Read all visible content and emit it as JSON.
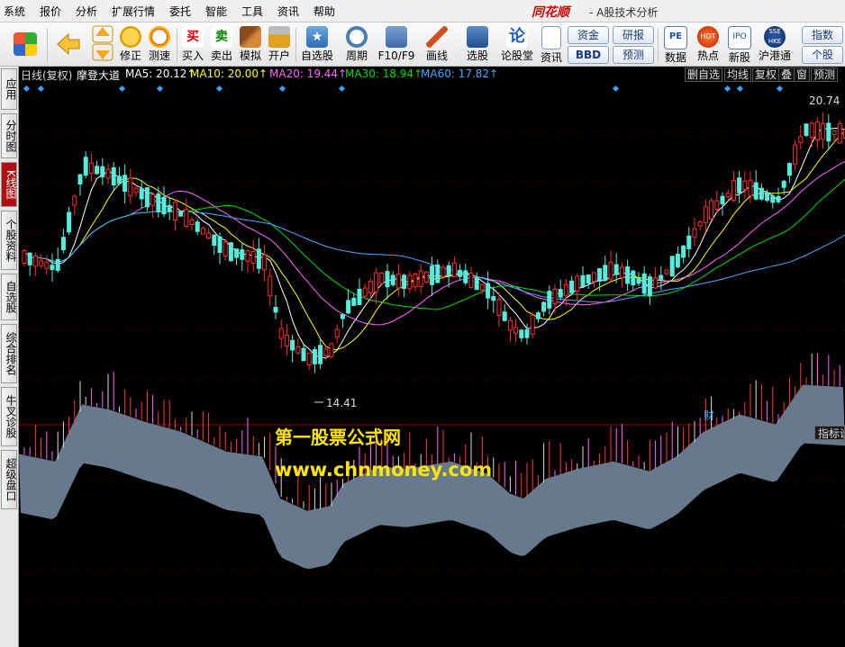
{
  "menu": [
    "系统",
    "报价",
    "分析",
    "扩展行情",
    "委托",
    "智能",
    "工具",
    "资讯",
    "帮助"
  ],
  "app": {
    "logo": "同花顺",
    "subtitle": "- A股技术分析"
  },
  "toolbar": {
    "buttons": [
      {
        "label": "",
        "icon": "windows-grid-icon"
      },
      {
        "label": "",
        "icon": "back-arrow-icon"
      },
      {
        "label": "修正",
        "icon": "refresh-icon"
      },
      {
        "label": "测速",
        "icon": "clock-icon"
      },
      {
        "label": "买入",
        "icon": "buy-icon"
      },
      {
        "label": "卖出",
        "icon": "sell-icon"
      },
      {
        "label": "模拟",
        "icon": "hammer-icon"
      },
      {
        "label": "开户",
        "icon": "lock-icon"
      },
      {
        "label": "自选股",
        "icon": "star-folder-icon"
      },
      {
        "label": "周期",
        "icon": "cycle-icon"
      },
      {
        "label": "F10/F9",
        "icon": "f10-icon"
      },
      {
        "label": "画线",
        "icon": "pen-icon"
      },
      {
        "label": "选股",
        "icon": "monitor-icon"
      },
      {
        "label": "论股堂",
        "icon": "lun-icon"
      },
      {
        "label": "资讯",
        "icon": "document-icon"
      },
      {
        "label": "数据",
        "icon": "pe-icon"
      },
      {
        "label": "热点",
        "icon": "hot-icon"
      },
      {
        "label": "新股",
        "icon": "ipo-icon"
      },
      {
        "label": "沪港通",
        "icon": "sse-hke-icon"
      }
    ],
    "pills": [
      "资金",
      "研报",
      "BBD",
      "预测",
      "指数",
      "个股"
    ]
  },
  "left_tabs": [
    "应用",
    "分时图",
    "K线图",
    "个股资料",
    "自选股",
    "综合排名",
    "牛叉诊股",
    "超级盘口"
  ],
  "active_tab": "K线图",
  "infobar": {
    "period": "日线(复权)",
    "indicator": "摩登大道",
    "ma": [
      {
        "label": "MA5: 20.12",
        "color": "#ffffff"
      },
      {
        "label": "MA10: 20.00",
        "color": "#ffff00"
      },
      {
        "label": "MA20: 19.44",
        "color": "#ff66ff"
      },
      {
        "label": "MA30: 18.94",
        "color": "#00dd00"
      },
      {
        "label": "MA60: 17.82",
        "color": "#44aaff"
      }
    ],
    "right_buttons": [
      "删自选",
      "均线",
      "复权",
      "叠",
      "窗",
      "预测"
    ]
  },
  "chart_data": {
    "type": "candlestick",
    "price_high_label": "20.74",
    "price_low_label": "14.41",
    "event_marker": "财",
    "indicator_button": "指标说",
    "colors": {
      "up": "#ff2a2a",
      "down": "#55eedd",
      "band": "#6e7f92"
    }
  },
  "watermark": {
    "line1": "第一股票公式网",
    "line2": "www.chnmoney.com"
  }
}
